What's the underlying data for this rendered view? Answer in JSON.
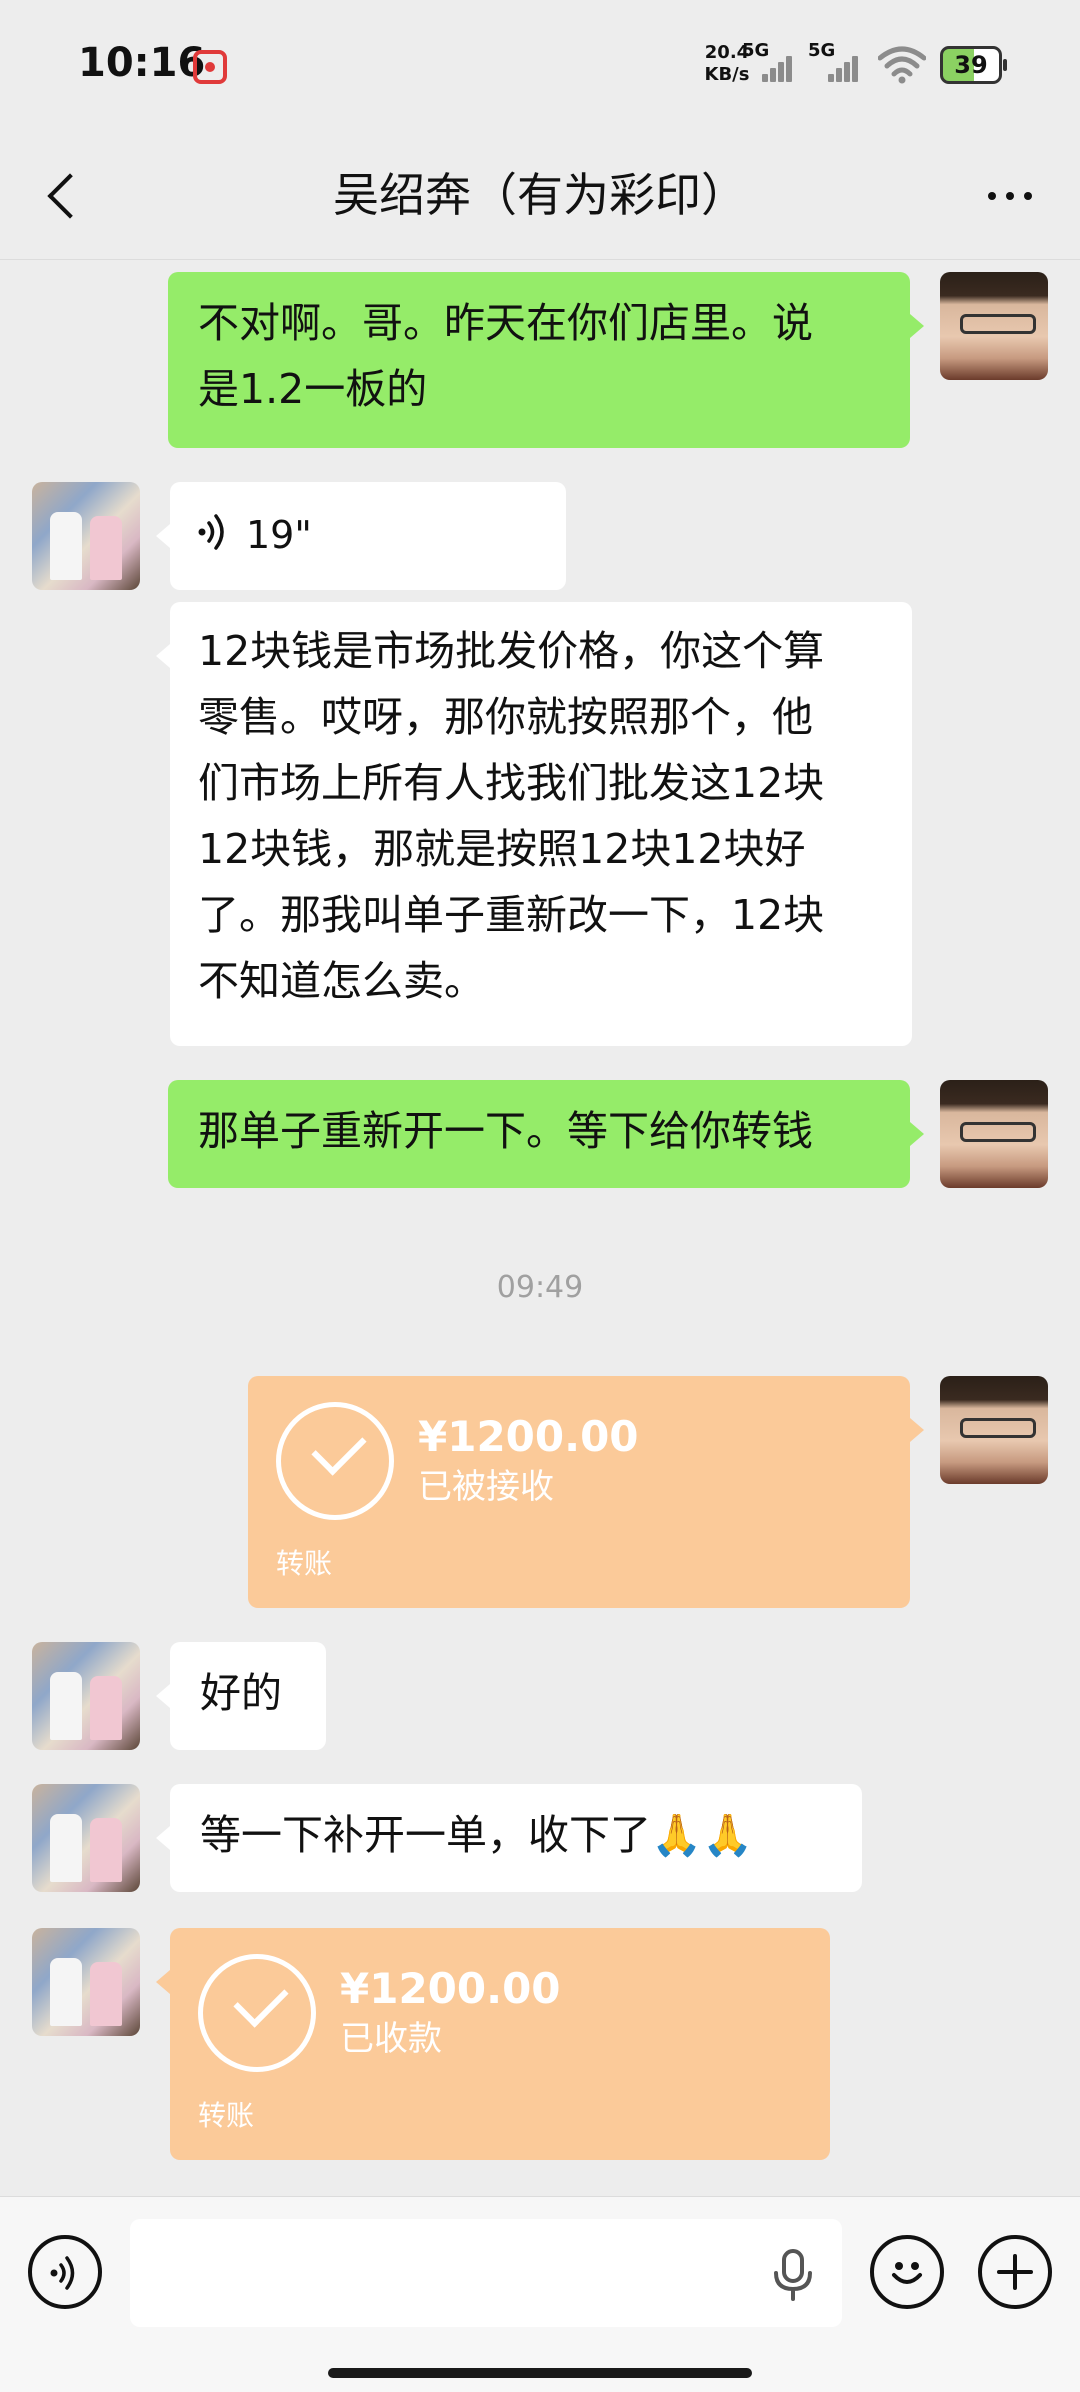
{
  "status_bar": {
    "time": "10:16",
    "net_speed_value": "20.4",
    "net_speed_unit": "KB/s",
    "network_1": "5G",
    "network_2": "5G",
    "battery": "39"
  },
  "header": {
    "title": "吴绍奔（有为彩印）"
  },
  "messages": {
    "m1": {
      "sender": "me",
      "text_l1": "不对啊。哥。昨天在你们店里。说",
      "text_l2": "是1.2一板的"
    },
    "m2": {
      "sender": "them",
      "type": "voice",
      "duration": "19\""
    },
    "m3": {
      "sender": "them",
      "lines": [
        "12块钱是市场批发价格，你这个算",
        "零售。哎呀，那你就按照那个，他",
        "们市场上所有人找我们批发这12块",
        "12块钱，那就是按照12块12块好",
        "了。那我叫单子重新改一下，12块",
        "不知道怎么卖。"
      ]
    },
    "m4": {
      "sender": "me",
      "text": "那单子重新开一下。等下给你转钱"
    },
    "time_separator": "09:49",
    "m5": {
      "sender": "me",
      "type": "transfer",
      "amount": "¥1200.00",
      "status": "已被接收",
      "label": "转账"
    },
    "m6": {
      "sender": "them",
      "text": "好的"
    },
    "m7": {
      "sender": "them",
      "text": "等一下补开一单，收下了🙏🙏"
    },
    "m8": {
      "sender": "them",
      "type": "transfer",
      "amount": "¥1200.00",
      "status": "已收款",
      "label": "转账"
    }
  },
  "colors": {
    "background": "#ededed",
    "my_bubble": "#95ec69",
    "their_bubble": "#ffffff",
    "transfer_card": "#fbca99"
  },
  "input_bar": {
    "placeholder": ""
  }
}
